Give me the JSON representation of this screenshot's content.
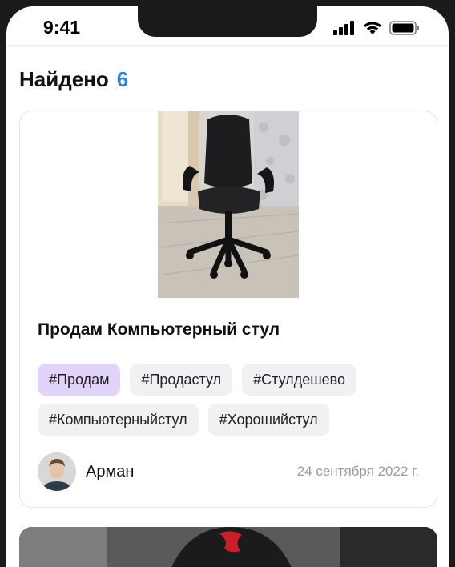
{
  "status_bar": {
    "time": "9:41"
  },
  "header": {
    "title": "Найдено",
    "count": "6"
  },
  "post": {
    "title": "Продам Компьютерный стул",
    "tags": [
      "#Продам",
      "#Продастул",
      "#Стулдешево",
      "#Компьютерныйстул",
      "#Хорошийстул"
    ],
    "author": "Арман",
    "date": "24 сентября 2022 г."
  },
  "colors": {
    "accent": "#2f86d8",
    "active_tag": "#e2d3fb",
    "tag_bg": "#f1f1f4"
  }
}
